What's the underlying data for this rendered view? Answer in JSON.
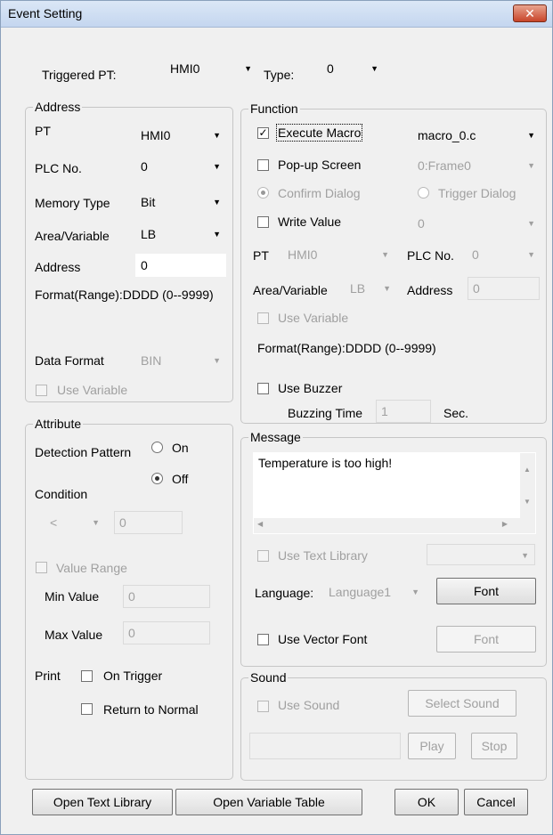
{
  "window": {
    "title": "Event Setting",
    "close_glyph": "✕"
  },
  "top": {
    "triggered_pt_label": "Triggered PT:",
    "triggered_pt_value": "HMI0",
    "type_label": "Type:",
    "type_value": "0"
  },
  "address": {
    "title": "Address",
    "pt_label": "PT",
    "pt_value": "HMI0",
    "plc_label": "PLC No.",
    "plc_value": "0",
    "memtype_label": "Memory Type",
    "memtype_value": "Bit",
    "area_label": "Area/Variable",
    "area_value": "LB",
    "addr_label": "Address",
    "addr_value": "0",
    "format": "Format(Range):DDDD (0--9999)",
    "dataformat_label": "Data Format",
    "dataformat_value": "BIN",
    "use_variable": "Use Variable"
  },
  "function": {
    "title": "Function",
    "exec_macro": "Execute Macro",
    "exec_macro_checked": true,
    "macro_value": "macro_0.c",
    "popup": "Pop-up Screen",
    "popup_value": "0:Frame0",
    "confirm": "Confirm Dialog",
    "trigger": "Trigger Dialog",
    "write_value": "Write Value",
    "write_value_value": "0",
    "pt_label": "PT",
    "pt_value": "HMI0",
    "plc_label": "PLC No.",
    "plc_value": "0",
    "area_label": "Area/Variable",
    "area_value": "LB",
    "addr_label": "Address",
    "addr_value": "0",
    "use_variable": "Use Variable",
    "format": "Format(Range):DDDD (0--9999)",
    "use_buzzer": "Use Buzzer",
    "buzz_label": "Buzzing Time",
    "buzz_value": "1",
    "buzz_unit": "Sec."
  },
  "attribute": {
    "title": "Attribute",
    "detection_label": "Detection Pattern",
    "on": "On",
    "off": "Off",
    "condition_label": "Condition",
    "condition_op": "<",
    "condition_value": "0",
    "value_range": "Value Range",
    "min_label": "Min Value",
    "min_value": "0",
    "max_label": "Max Value",
    "max_value": "0",
    "print_label": "Print",
    "on_trigger": "On Trigger",
    "return_normal": "Return to Normal"
  },
  "message": {
    "title": "Message",
    "text": "Temperature is too high!",
    "use_text_library": "Use Text Library",
    "language_label": "Language:",
    "language_value": "Language1",
    "font_button": "Font",
    "use_vector_font": "Use Vector Font",
    "font_button2": "Font"
  },
  "sound": {
    "title": "Sound",
    "use_sound": "Use Sound",
    "select_sound": "Select Sound",
    "play": "Play",
    "stop": "Stop"
  },
  "footer": {
    "open_text_library": "Open Text Library",
    "open_variable_table": "Open Variable Table",
    "ok": "OK",
    "cancel": "Cancel"
  }
}
